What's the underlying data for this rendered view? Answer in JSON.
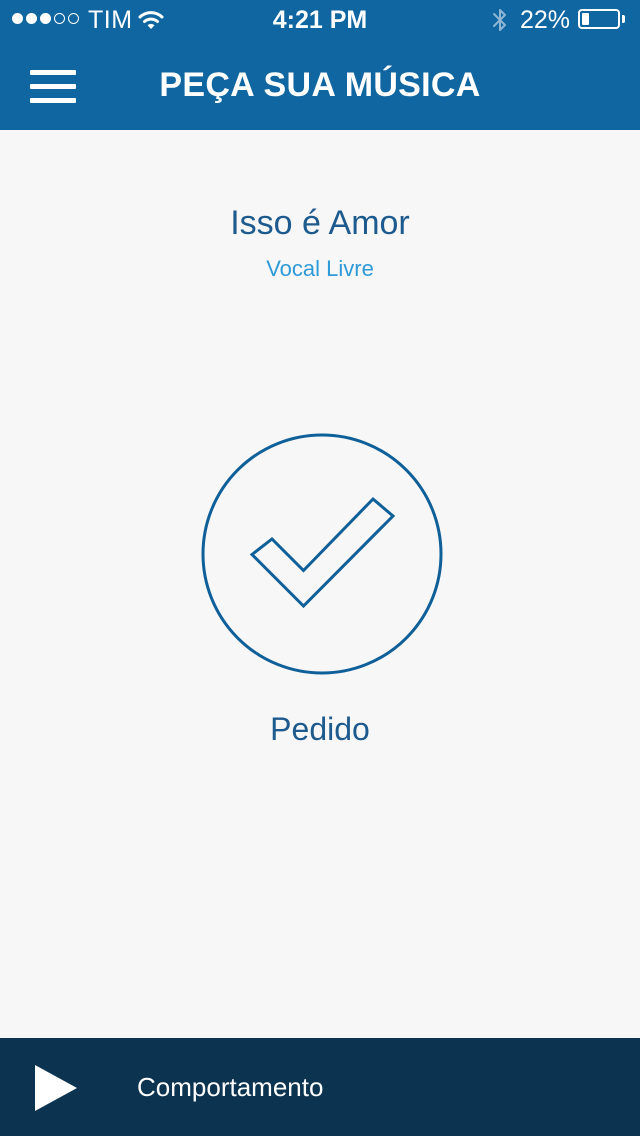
{
  "status_bar": {
    "carrier": "TIM",
    "time": "4:21 PM",
    "battery_percent": "22%",
    "battery_level": 0.22,
    "signal_strength": 3,
    "signal_max": 5
  },
  "header": {
    "title": "PEÇA SUA MÚSICA",
    "menu_icon": "hamburger-menu-icon"
  },
  "song": {
    "title": "Isso é Amor",
    "artist": "Vocal Livre"
  },
  "request": {
    "status_icon": "checkmark-circle-icon",
    "status_label": "Pedido"
  },
  "player": {
    "play_icon": "play-icon",
    "now_playing": "Comportamento"
  },
  "colors": {
    "header_background": "#0f66a1",
    "page_background": "#f7f7f7",
    "primary_text": "#1d5a8e",
    "accent_text": "#2e9ad8",
    "player_background": "#0c3350"
  }
}
